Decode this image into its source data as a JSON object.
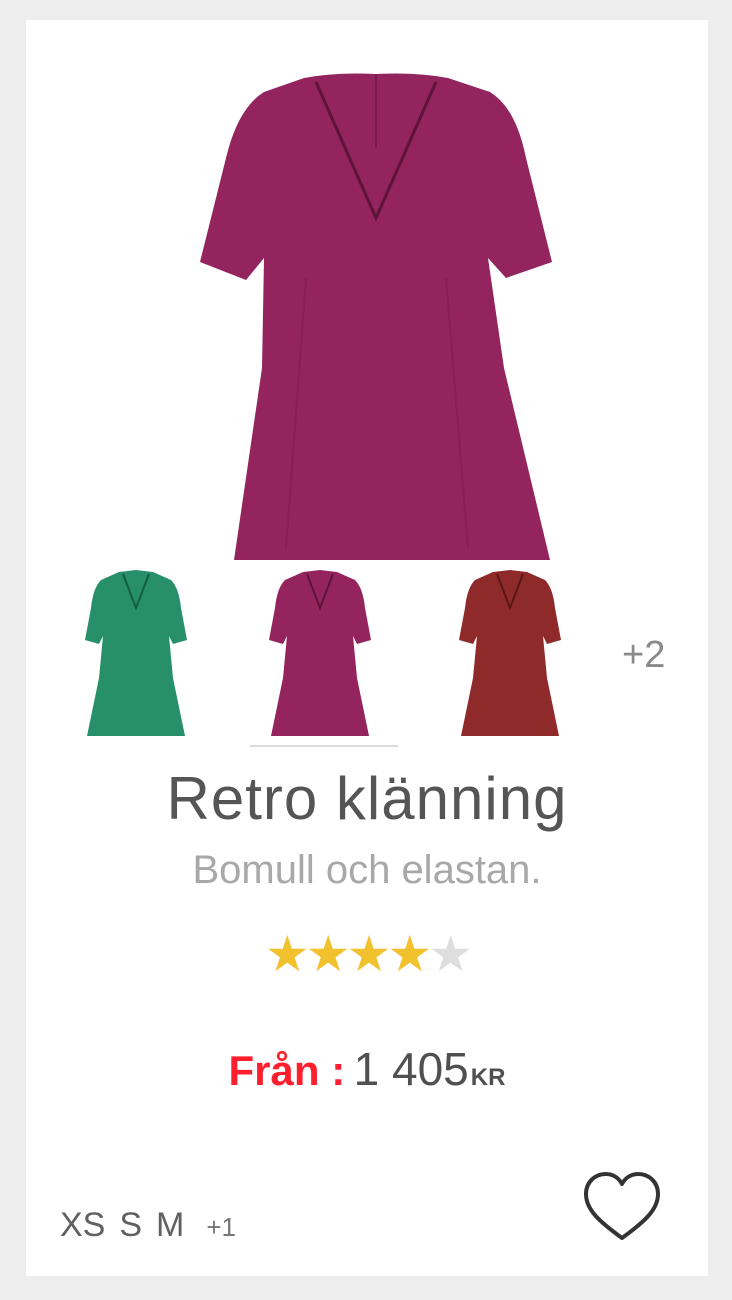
{
  "product": {
    "title": "Retro klänning",
    "subtitle": "Bomull och elastan.",
    "rating": 4,
    "rating_max": 5,
    "price_prefix": "Från :",
    "price_amount": "1 405",
    "price_currency": "KR"
  },
  "colors": {
    "main": "#93245e",
    "swatches": [
      "#27906b",
      "#93245e",
      "#8f2a2a"
    ],
    "selected_index": 1,
    "more_label": "+2"
  },
  "sizes": {
    "items": [
      "XS",
      "S",
      "M"
    ],
    "more_label": "+1"
  },
  "theme": {
    "price_prefix_color": "#ff1f2d",
    "star_filled": "#f2c12e",
    "star_empty": "#dedede"
  },
  "icons": {
    "wishlist": "heart-outline-icon",
    "star": "star-icon"
  }
}
